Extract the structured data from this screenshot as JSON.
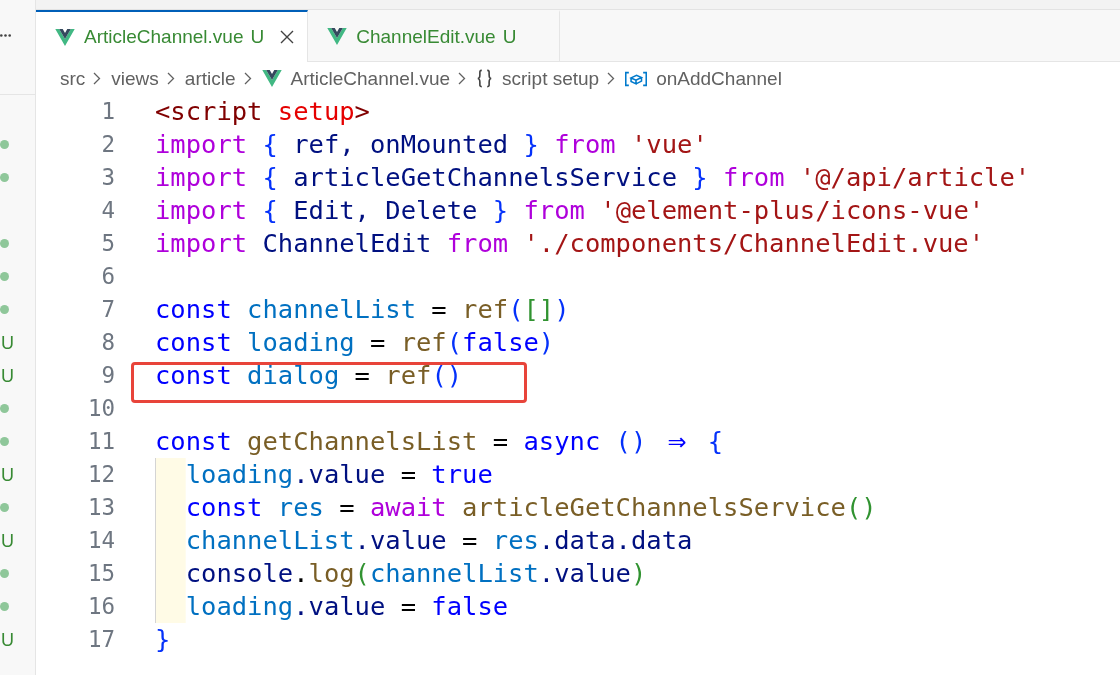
{
  "sidebar": {
    "rows": [
      {
        "kind": "blank"
      },
      {
        "kind": "dot"
      },
      {
        "kind": "dot"
      },
      {
        "kind": "blank"
      },
      {
        "kind": "dot"
      },
      {
        "kind": "dot"
      },
      {
        "kind": "dot"
      },
      {
        "kind": "letter",
        "text": "U"
      },
      {
        "kind": "letter",
        "text": "U"
      },
      {
        "kind": "dot"
      },
      {
        "kind": "dot"
      },
      {
        "kind": "letter",
        "text": "U"
      },
      {
        "kind": "dot"
      },
      {
        "kind": "letter",
        "text": "U"
      },
      {
        "kind": "dot"
      },
      {
        "kind": "dot"
      },
      {
        "kind": "letter",
        "text": "U"
      }
    ]
  },
  "tabs": [
    {
      "label": "ArticleChannel.vue",
      "status": "U",
      "selected": true
    },
    {
      "label": "ChannelEdit.vue",
      "status": "U",
      "selected": false
    }
  ],
  "breadcrumb": [
    {
      "label": "src",
      "kind": "folder"
    },
    {
      "label": "views",
      "kind": "folder"
    },
    {
      "label": "article",
      "kind": "folder"
    },
    {
      "label": "ArticleChannel.vue",
      "kind": "vue-file"
    },
    {
      "label": "script setup",
      "kind": "namespace"
    },
    {
      "label": "onAddChannel",
      "kind": "variable"
    }
  ],
  "editor": {
    "lines": [
      {
        "number": "1",
        "highlighted": false,
        "tokens": [
          {
            "text": "<script",
            "kind": "tag"
          },
          {
            "text": " setup",
            "kind": "attribute"
          },
          {
            "text": ">",
            "kind": "tag"
          }
        ]
      },
      {
        "number": "2",
        "highlighted": false,
        "tokens": [
          {
            "text": "import",
            "kind": "keyword"
          },
          {
            "text": " {",
            "kind": "bracket1"
          },
          {
            "text": " ref, onMounted",
            "kind": "variable"
          },
          {
            "text": " }",
            "kind": "bracket1"
          },
          {
            "text": " from",
            "kind": "keyword"
          },
          {
            "text": " 'vue'",
            "kind": "string"
          }
        ]
      },
      {
        "number": "3",
        "highlighted": false,
        "tokens": [
          {
            "text": "import",
            "kind": "keyword"
          },
          {
            "text": " {",
            "kind": "bracket1"
          },
          {
            "text": " articleGetChannelsService",
            "kind": "variable"
          },
          {
            "text": " }",
            "kind": "bracket1"
          },
          {
            "text": " from",
            "kind": "keyword"
          },
          {
            "text": " '@/api/article'",
            "kind": "string"
          }
        ]
      },
      {
        "number": "4",
        "highlighted": false,
        "tokens": [
          {
            "text": "import",
            "kind": "keyword"
          },
          {
            "text": " {",
            "kind": "bracket1"
          },
          {
            "text": " Edit, Delete",
            "kind": "variable"
          },
          {
            "text": " }",
            "kind": "bracket1"
          },
          {
            "text": " from",
            "kind": "keyword"
          },
          {
            "text": " '@element-plus/icons-vue'",
            "kind": "string"
          }
        ]
      },
      {
        "number": "5",
        "highlighted": false,
        "tokens": [
          {
            "text": "import",
            "kind": "keyword"
          },
          {
            "text": " ChannelEdit",
            "kind": "variable"
          },
          {
            "text": " from",
            "kind": "keyword"
          },
          {
            "text": " './components/ChannelEdit.vue'",
            "kind": "string"
          }
        ]
      },
      {
        "number": "6",
        "highlighted": false
      },
      {
        "number": "7",
        "highlighted": false,
        "tokens": [
          {
            "text": "const",
            "kind": "storage"
          },
          {
            "text": " channelList",
            "kind": "constant"
          },
          {
            "text": " =",
            "kind": "operator"
          },
          {
            "text": " ref",
            "kind": "function"
          },
          {
            "text": "(",
            "kind": "bracket1"
          },
          {
            "text": "[",
            "kind": "bracket2"
          },
          {
            "text": "]",
            "kind": "bracket2"
          },
          {
            "text": ")",
            "kind": "bracket1"
          }
        ]
      },
      {
        "number": "8",
        "highlighted": false,
        "tokens": [
          {
            "text": "const",
            "kind": "storage"
          },
          {
            "text": " loading",
            "kind": "constant"
          },
          {
            "text": " =",
            "kind": "operator"
          },
          {
            "text": " ref",
            "kind": "function"
          },
          {
            "text": "(",
            "kind": "bracket1"
          },
          {
            "text": "false",
            "kind": "storage"
          },
          {
            "text": ")",
            "kind": "bracket1"
          }
        ]
      },
      {
        "number": "9",
        "highlighted": true,
        "tokens": [
          {
            "text": "const",
            "kind": "storage"
          },
          {
            "text": " dialog",
            "kind": "constant"
          },
          {
            "text": " =",
            "kind": "operator"
          },
          {
            "text": " ref",
            "kind": "function"
          },
          {
            "text": "(",
            "kind": "bracket1"
          },
          {
            "text": ")",
            "kind": "bracket1"
          }
        ]
      },
      {
        "number": "10",
        "highlighted": false
      },
      {
        "number": "11",
        "highlighted": false,
        "tokens": [
          {
            "text": "const",
            "kind": "storage"
          },
          {
            "text": " getChannelsList",
            "kind": "function"
          },
          {
            "text": " =",
            "kind": "operator"
          },
          {
            "text": " async",
            "kind": "storage"
          },
          {
            "text": " (",
            "kind": "bracket1"
          },
          {
            "text": ") ",
            "kind": "bracket1"
          },
          {
            "text": "⇒",
            "kind": "arrow"
          },
          {
            "text": " {",
            "kind": "bracket1"
          }
        ],
        "children": [
          {
            "number": "12",
            "highlighted": false,
            "tokens": [
              {
                "text": "loading",
                "kind": "constant"
              },
              {
                "text": ".value",
                "kind": "variable"
              },
              {
                "text": " =",
                "kind": "operator"
              },
              {
                "text": " true",
                "kind": "storage"
              }
            ]
          },
          {
            "number": "13",
            "highlighted": false,
            "tokens": [
              {
                "text": "const",
                "kind": "storage"
              },
              {
                "text": " res",
                "kind": "constant"
              },
              {
                "text": " =",
                "kind": "operator"
              },
              {
                "text": " await",
                "kind": "keyword"
              },
              {
                "text": " articleGetChannelsService",
                "kind": "function"
              },
              {
                "text": "(",
                "kind": "bracket2"
              },
              {
                "text": ")",
                "kind": "bracket2"
              }
            ]
          },
          {
            "number": "14",
            "highlighted": false,
            "tokens": [
              {
                "text": "channelList",
                "kind": "constant"
              },
              {
                "text": ".value",
                "kind": "variable"
              },
              {
                "text": " =",
                "kind": "operator"
              },
              {
                "text": " res",
                "kind": "constant"
              },
              {
                "text": ".data.data",
                "kind": "variable"
              }
            ]
          },
          {
            "number": "15",
            "highlighted": false,
            "tokens": [
              {
                "text": "console",
                "kind": "variable"
              },
              {
                "text": ".",
                "kind": "operator"
              },
              {
                "text": "log",
                "kind": "function"
              },
              {
                "text": "(",
                "kind": "bracket2"
              },
              {
                "text": "channelList",
                "kind": "constant"
              },
              {
                "text": ".value",
                "kind": "variable"
              },
              {
                "text": ")",
                "kind": "bracket2"
              }
            ]
          },
          {
            "number": "16",
            "highlighted": false,
            "tokens": [
              {
                "text": "loading",
                "kind": "constant"
              },
              {
                "text": ".value",
                "kind": "variable"
              },
              {
                "text": " =",
                "kind": "operator"
              },
              {
                "text": " false",
                "kind": "storage"
              }
            ]
          }
        ]
      },
      {
        "number": "17",
        "highlighted": false,
        "tokens": [
          {
            "text": "}",
            "kind": "bracket1"
          }
        ]
      }
    ]
  }
}
